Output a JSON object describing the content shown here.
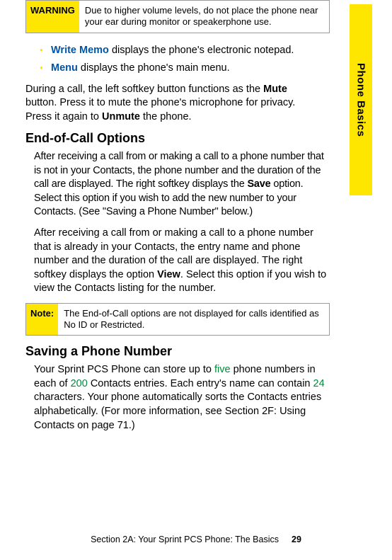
{
  "side_tab": "Phone Basics",
  "warning": {
    "label": "WARNING",
    "text": "Due to higher volume levels, do not place the phone near your ear during monitor or speakerphone use."
  },
  "bullets": [
    {
      "lead": "Write Memo",
      "rest": " displays the phone's electronic notepad."
    },
    {
      "lead": "Menu",
      "rest": " displays the phone's main menu."
    }
  ],
  "mute_para_1": "During a call, the left softkey button functions as the ",
  "mute_bold_1": "Mute",
  "mute_para_2": " button. Press it to mute the phone's microphone for privacy. Press it again to ",
  "mute_bold_2": "Unmute",
  "mute_para_3": " the phone.",
  "heading_eoc": "End-of-Call Options",
  "eoc_p1_a": "After receiving a call from or making a call to a phone number that is not in your Contacts, the phone number and the duration of the call are displayed. The right softkey displays the ",
  "eoc_p1_b": "Save",
  "eoc_p1_c": " option. Select this option if you wish to add the new number to your Contacts. (See \"Saving a Phone Number\" below.)",
  "eoc_p2_a": "After receiving a call from or making a call to a phone number that is already in your Contacts, the entry name and phone number and the duration of the call are displayed. The right softkey displays the option ",
  "eoc_p2_b": "View",
  "eoc_p2_c": ". Select this option if you wish to view the Contacts listing for the number.",
  "note": {
    "label": "Note:",
    "text": "The End-of-Call options are not displayed for calls identified as No ID or Restricted."
  },
  "heading_save": "Saving a Phone Number",
  "save_p_a": "Your Sprint PCS Phone can store up to ",
  "save_five": "five",
  "save_p_b": " phone numbers in each of ",
  "save_200": "200",
  "save_p_c": " Contacts entries. Each entry's name can contain ",
  "save_24": "24",
  "save_p_d": " characters. Your phone automatically sorts the Contacts entries alphabetically. (For more information, see Section 2F: Using Contacts on page 71.)",
  "footer_section": "Section 2A: Your Sprint PCS Phone: The Basics",
  "footer_page": "29"
}
